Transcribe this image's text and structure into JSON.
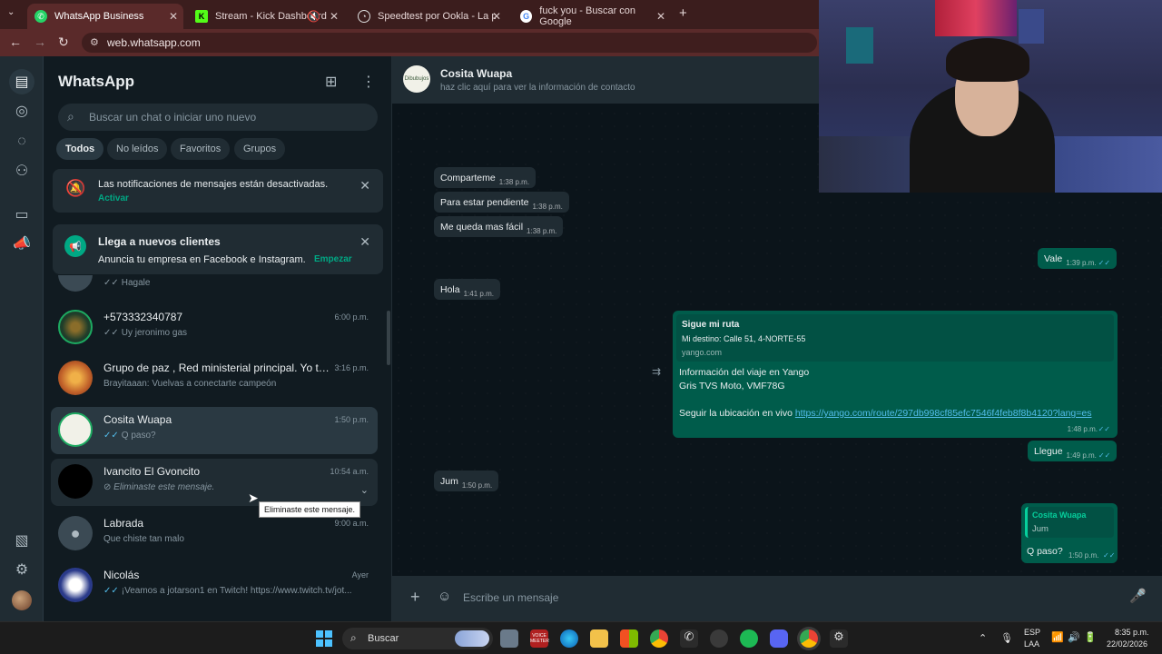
{
  "browser": {
    "tabs": [
      {
        "label": "WhatsApp Business",
        "active": true
      },
      {
        "label": "Stream - Kick Dashboard",
        "active": false
      },
      {
        "label": "Speedtest por Ookla - La prueb",
        "active": false
      },
      {
        "label": "fuck you - Buscar con Google",
        "active": false
      }
    ],
    "url": "web.whatsapp.com",
    "new_tab_label": "+"
  },
  "sidebar": {
    "title": "WhatsApp",
    "search_placeholder": "Buscar un chat o iniciar uno nuevo",
    "filters": [
      "Todos",
      "No leídos",
      "Favoritos",
      "Grupos"
    ],
    "notif_banner": {
      "text": "Las notificaciones de mensajes están desactivadas.",
      "action": "Activar"
    },
    "promo_banner": {
      "title": "Llega a nuevos clientes",
      "text": "Anuncia tu empresa en Facebook e Instagram.",
      "action": "Empezar"
    },
    "partial_preview": "Hagale",
    "chats": [
      {
        "name": "+573332340787",
        "time": "6:00 p.m.",
        "preview": "Uy jeronimo gas",
        "ticks": "✓✓"
      },
      {
        "name": "Grupo de paz , Red ministerial principal. Yo te...",
        "time": "3:16 p.m.",
        "preview": "Brayitaaan: Vuelvas a conectarte campeón",
        "ticks": ""
      },
      {
        "name": "Cosita Wuapa",
        "time": "1:50 p.m.",
        "preview": "Q paso?",
        "ticks": "✓✓"
      },
      {
        "name": "Ivancito El Gvoncito",
        "time": "10:54 a.m.",
        "preview": "Eliminaste este mensaje.",
        "ticks": ""
      },
      {
        "name": "Labrada",
        "time": "9:00 a.m.",
        "preview": "Que chiste tan malo",
        "ticks": ""
      },
      {
        "name": "Nicolás",
        "time": "Ayer",
        "preview": "¡Veamos a jotarson1 en Twitch! https://www.twitch.tv/jot...",
        "ticks": "✓✓"
      }
    ],
    "tooltip": "Eliminaste este mensaje."
  },
  "conversation": {
    "contact_name": "Cosita Wuapa",
    "contact_sub": "haz clic aquí para ver la información de contacto",
    "avatar_text": "Dibubujos",
    "messages": [
      {
        "dir": "in",
        "text": "Comparteme",
        "time": "1:38 p.m."
      },
      {
        "dir": "in",
        "text": "Para estar pendiente",
        "time": "1:38 p.m."
      },
      {
        "dir": "in",
        "text": "Me queda mas fácil",
        "time": "1:38 p.m."
      },
      {
        "dir": "out",
        "text": "Vale",
        "time": "1:39 p.m."
      },
      {
        "dir": "in",
        "text": "Hola",
        "time": "1:41 p.m."
      },
      {
        "dir": "out",
        "text": "Llegue",
        "time": "1:49 p.m."
      },
      {
        "dir": "in",
        "text": "Jum",
        "time": "1:50 p.m."
      }
    ],
    "link_message": {
      "preview_title": "Sigue mi ruta",
      "preview_desc": "Mi destino: Calle 51, 4-NORTE-55",
      "preview_domain": "yango.com",
      "line1": "Información del viaje en Yango",
      "line2": "Gris TVS Moto, VMF78G",
      "line3": "Seguir la ubicación en vivo",
      "link": "https://yango.com/route/297db998cf85efc7546f4feb8f8b4120?lang=es",
      "time": "1:48 p.m."
    },
    "quoted_message": {
      "quote_author": "Cosita Wuapa",
      "quote_text": "Jum",
      "text": "Q paso?",
      "time": "1:50 p.m."
    },
    "composer_placeholder": "Escribe un mensaje"
  },
  "taskbar": {
    "search": "Buscar",
    "lang_top": "ESP",
    "lang_bottom": "LAA",
    "time": "8:35 p.m.",
    "date": "22/02/2026",
    "voicemeeter": "VOICE MEETER"
  },
  "colors": {
    "accent": "#00a884",
    "outgoing_bubble": "#005c4b",
    "incoming_bubble": "#202c33",
    "tick_blue": "#53bdeb"
  }
}
